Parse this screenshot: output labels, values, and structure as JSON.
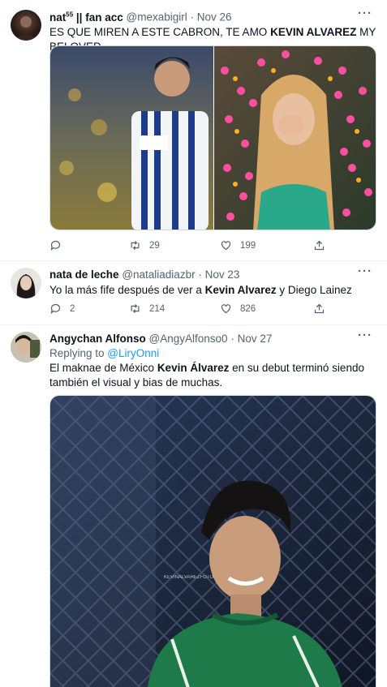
{
  "tweets": [
    {
      "name": "nat",
      "name_sup": "55",
      "name_rest": " || fan acc",
      "handle": "@mexabigirl",
      "date": "Nov 26",
      "text_1": "ES QUE MIREN A ESTE CABRON, TE AMO ",
      "text_bold": "KEVIN ALVAREZ",
      "text_2": " MY BELOVED",
      "replies": "",
      "retweets": "29",
      "likes": "199"
    },
    {
      "name": "nata de leche",
      "handle": "@nataliadiazbr",
      "date": "Nov 23",
      "text_1": "Yo la más fife después de ver a ",
      "text_bold": "Kevin Alvarez",
      "text_2": " y Diego Lainez",
      "replies": "2",
      "retweets": "214",
      "likes": "826"
    },
    {
      "name": "Angychan Alfonso",
      "handle": "@AngyAlfonso0",
      "date": "Nov 27",
      "replying_label": "Replying to ",
      "replying_handle": "@LiryOnni",
      "text_1": "El maknae de México ",
      "text_bold": "Kevin Álvarez",
      "text_2": " en su debut terminó siendo también el visual y bias de muchas.",
      "watermark": "KEVINALVAREZFOTO"
    }
  ],
  "colors": {
    "accent": "#1d9bf0",
    "secondary_text": "#536471",
    "primary_text": "#0f1419"
  },
  "icons": [
    "reply-icon",
    "retweet-icon",
    "like-icon",
    "share-icon",
    "more-icon"
  ]
}
